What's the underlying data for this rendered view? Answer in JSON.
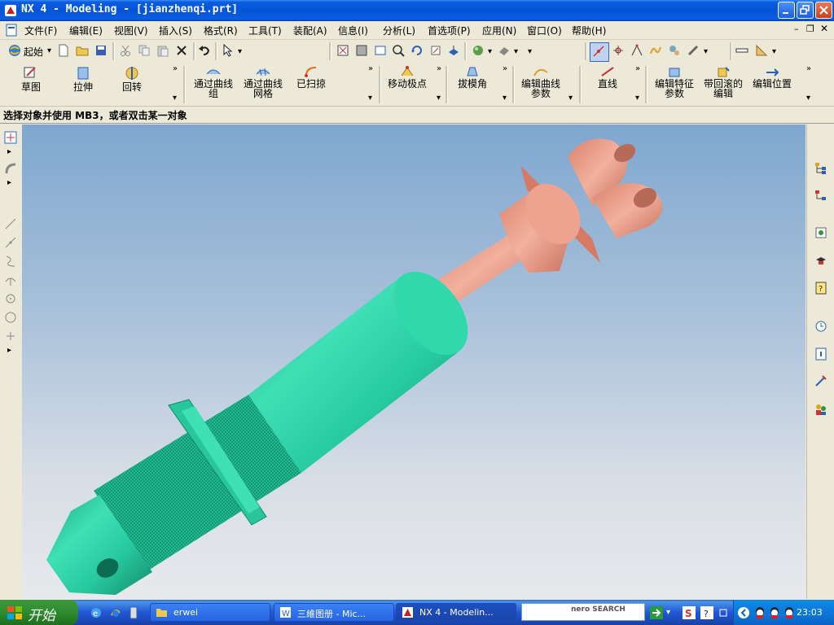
{
  "window": {
    "title": "NX 4 - Modeling - [jianzhenqi.prt]"
  },
  "menu": {
    "items": [
      "文件(F)",
      "编辑(E)",
      "视图(V)",
      "插入(S)",
      "格式(R)",
      "工具(T)",
      "装配(A)",
      "信息(I)",
      "分析(L)",
      "首选项(P)",
      "应用(N)",
      "窗口(O)",
      "帮助(H)"
    ]
  },
  "toolbar": {
    "start_label": "起始"
  },
  "features": {
    "sketch": "草图",
    "extrude": "拉伸",
    "revolve": "回转",
    "through_curves_1": "通过曲线",
    "through_curves_2": "组",
    "through_mesh_1": "通过曲线",
    "through_mesh_2": "网格",
    "swept": "已扫掠",
    "move_pole": "移动极点",
    "draft": "拔模角",
    "edit_curve_1": "编辑曲线",
    "edit_curve_2": "参数",
    "line": "直线",
    "edit_feature_1": "编辑特征",
    "edit_feature_2": "参数",
    "rollback_1": "带回滚的",
    "rollback_2": "编辑",
    "edit_position": "编辑位置"
  },
  "cue_line": "选择对象并使用 MB3，或者双击某一对象",
  "colors": {
    "cylinder": "#27c9a0",
    "rod": "#e79b86",
    "titlebar": "#0a5ce0"
  },
  "taskbar": {
    "start": "开始",
    "tasks": [
      "erwei",
      "三維图册 - Mic...",
      "NX 4 - Modelin..."
    ],
    "search_brand": "nero SEARCH",
    "clock": "23:03"
  }
}
